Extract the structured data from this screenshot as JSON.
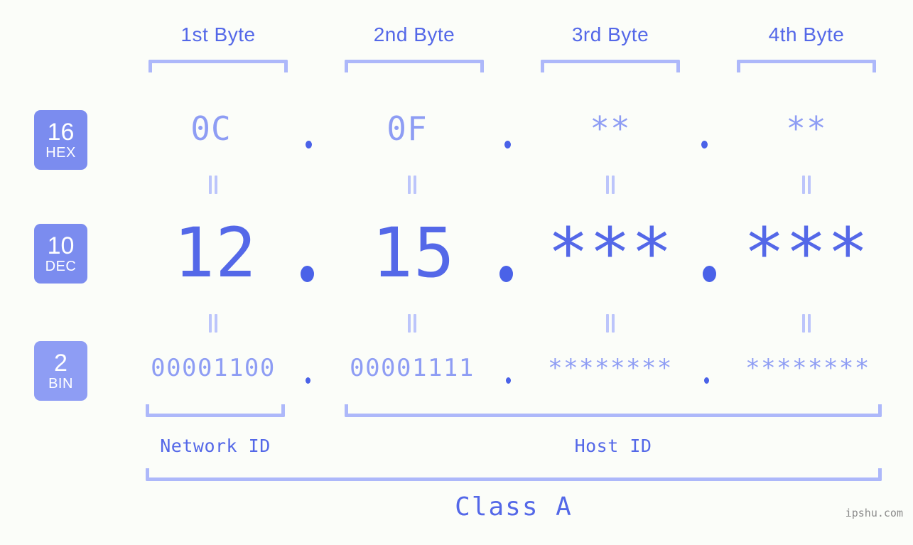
{
  "page": {
    "background_color": "#fbfdf9",
    "accent_color": "#5468e8",
    "accent_light_color": "#8e9df4",
    "bracket_color": "#adb8fa",
    "badge_color": "#7b8cef",
    "watermark": "ipshu.com"
  },
  "byte_headers": [
    {
      "label": "1st Byte"
    },
    {
      "label": "2nd Byte"
    },
    {
      "label": "3rd Byte"
    },
    {
      "label": "4th Byte"
    }
  ],
  "rows": [
    {
      "badge_number": "16",
      "badge_name": "HEX",
      "values": [
        "0C",
        "0F",
        "**",
        "**"
      ],
      "separator": "."
    },
    {
      "badge_number": "10",
      "badge_name": "DEC",
      "values": [
        "12",
        "15",
        "***",
        "***"
      ],
      "separator": "."
    },
    {
      "badge_number": "2",
      "badge_name": "BIN",
      "values": [
        "00001100",
        "00001111",
        "********",
        "********"
      ],
      "separator": "."
    }
  ],
  "equality_marker": "=",
  "sections": [
    {
      "label": "Network ID"
    },
    {
      "label": "Host ID"
    }
  ],
  "class": {
    "label": "Class A"
  }
}
